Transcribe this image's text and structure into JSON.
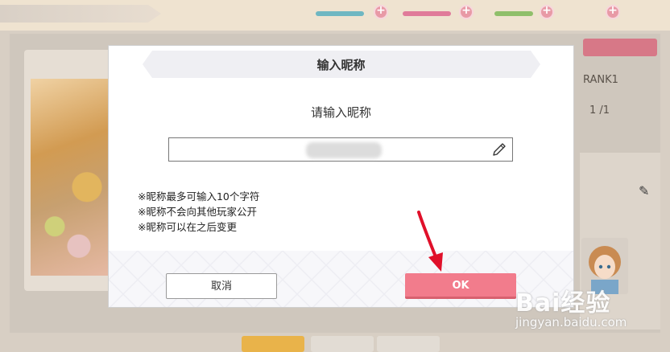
{
  "background": {
    "rank_label": "RANK1",
    "page_indicator": "1 /1"
  },
  "dialog": {
    "title": "输入昵称",
    "subtitle": "请输入昵称",
    "nickname_field": {
      "value": "",
      "placeholder": ""
    },
    "notes": [
      "※昵称最多可输入10个字符",
      "※昵称不会向其他玩家公开",
      "※昵称可以在之后变更"
    ],
    "cancel_label": "取消",
    "ok_label": "OK"
  },
  "watermark": {
    "logo": "Bai经验",
    "url": "jingyan.baidu.com"
  },
  "colors": {
    "ok_button": "#f27c8c",
    "annotation_arrow": "#e0102a"
  }
}
